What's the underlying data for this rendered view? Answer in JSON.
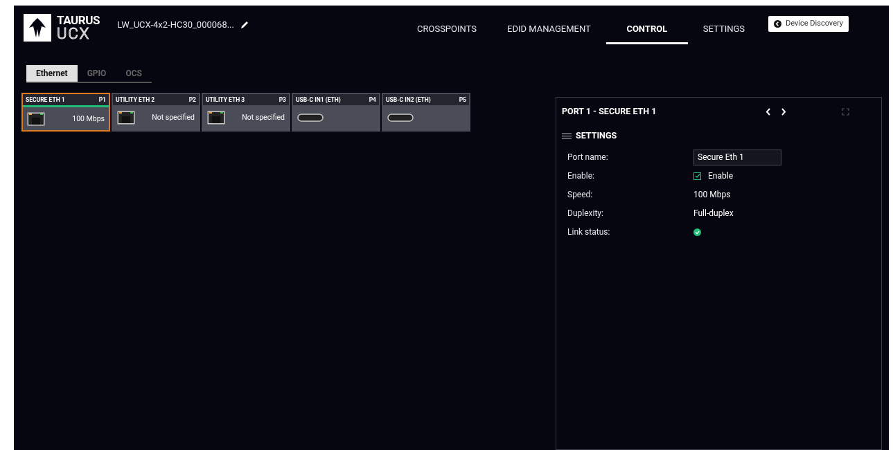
{
  "header": {
    "logo_top": "TAURUS",
    "logo_bottom": "UCX",
    "device_name": "LW_UCX-4x2-HC30_000068...",
    "nav": [
      {
        "label": "CROSSPOINTS",
        "selected": false
      },
      {
        "label": "EDID MANAGEMENT",
        "selected": false
      },
      {
        "label": "CONTROL",
        "selected": true
      },
      {
        "label": "SETTINGS",
        "selected": false
      }
    ],
    "discovery_button": "Device Discovery"
  },
  "subtabs": [
    {
      "label": "Ethernet",
      "selected": true
    },
    {
      "label": "GPIO",
      "selected": false
    },
    {
      "label": "OCS",
      "selected": false
    }
  ],
  "ports": [
    {
      "name": "SECURE ETH 1",
      "number": "P1",
      "kind": "ethernet",
      "status": "100 Mbps",
      "selected": true,
      "linked": true
    },
    {
      "name": "UTILITY ETH 2",
      "number": "P2",
      "kind": "ethernet",
      "status": "Not specified",
      "selected": false,
      "linked": false
    },
    {
      "name": "UTILITY ETH 3",
      "number": "P3",
      "kind": "ethernet",
      "status": "Not specified",
      "selected": false,
      "linked": false
    },
    {
      "name": "USB-C IN1 (ETH)",
      "number": "P4",
      "kind": "usbc",
      "selected": false,
      "linked": false
    },
    {
      "name": "USB-C IN2 (ETH)",
      "number": "P5",
      "kind": "usbc",
      "selected": false,
      "linked": false
    }
  ],
  "panel": {
    "title": "PORT 1 - SECURE ETH 1",
    "section": "SETTINGS",
    "fields": [
      {
        "label": "Port name:",
        "kind": "input",
        "value": "Secure Eth 1"
      },
      {
        "label": "Enable:",
        "kind": "checkbox",
        "value": "Enable",
        "checked": true
      },
      {
        "label": "Speed:",
        "kind": "text",
        "value": "100 Mbps"
      },
      {
        "label": "Duplexity:",
        "kind": "text",
        "value": "Full-duplex"
      },
      {
        "label": "Link status:",
        "kind": "status",
        "ok": true
      }
    ]
  }
}
